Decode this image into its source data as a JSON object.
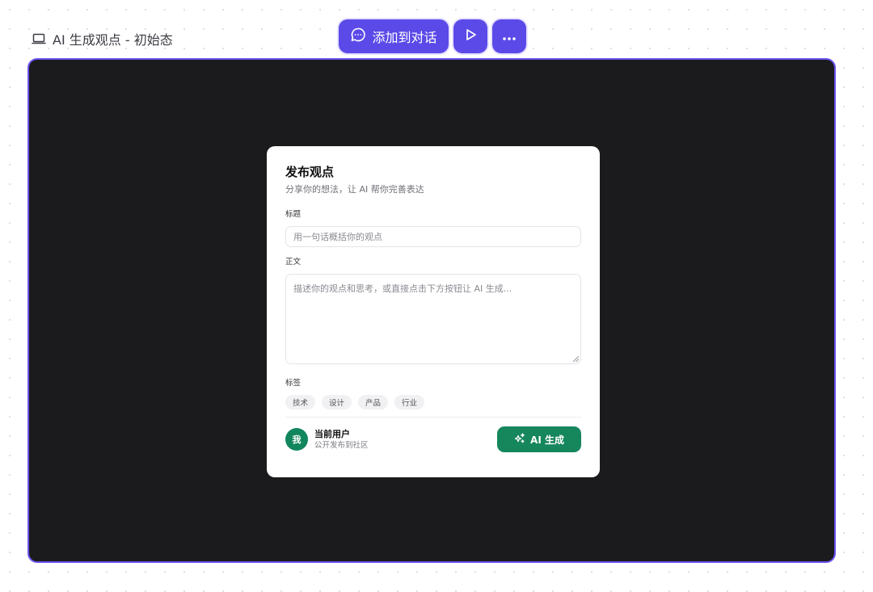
{
  "header": {
    "icon": "laptop-icon",
    "title": "AI 生成观点 - 初始态"
  },
  "toolbar": {
    "add_to_chat_label": "添加到对话",
    "add_to_chat_icon": "chat-bubble-icon",
    "play_icon": "play-icon",
    "more_icon": "more-horizontal-icon",
    "accent_color": "#5b4ae8"
  },
  "form": {
    "title": "发布观点",
    "subtitle": "分享你的想法，让 AI 帮你完善表达",
    "title_field": {
      "label": "标题",
      "placeholder": "用一句话概括你的观点"
    },
    "body_field": {
      "label": "正文",
      "placeholder": "描述你的观点和思考，或直接点击下方按钮让 AI 生成..."
    },
    "tags_label": "标签",
    "tags": [
      "技术",
      "设计",
      "产品",
      "行业"
    ],
    "user": {
      "avatar_text": "我",
      "name": "当前用户",
      "subtitle": "公开发布到社区"
    },
    "generate_button": {
      "label": "AI 生成",
      "icon": "sparkles-icon",
      "color": "#16865d"
    }
  }
}
